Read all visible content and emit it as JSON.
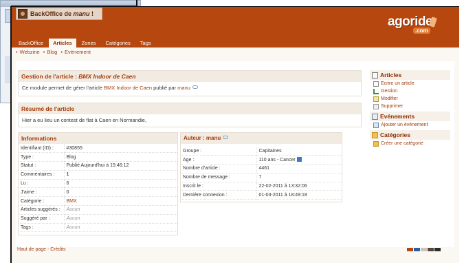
{
  "header": {
    "title_prefix": "BackOffice de ",
    "title_user": "manu",
    "title_suffix": " !",
    "brand_main": "agoride",
    "brand_sub": ".com"
  },
  "tabs": [
    {
      "label": "BackOffice",
      "active": false
    },
    {
      "label": "Articles",
      "active": true
    },
    {
      "label": "Zones",
      "active": false
    },
    {
      "label": "Catégories",
      "active": false
    },
    {
      "label": "Tags",
      "active": false
    }
  ],
  "subnav": [
    "Webzine",
    "Blog",
    "Evènement"
  ],
  "gestion": {
    "title_prefix": "Gestion de l'article : ",
    "title_article": "BMX Indoor de Caen",
    "body_prefix": "Ce module permet de gérer l'article ",
    "body_article": "BMX Indoor de Caen",
    "body_mid": " publié par ",
    "body_user": "manu"
  },
  "resume": {
    "title": "Résumé de l'article",
    "body": "Hier a eu lieu un contest de flat à Caen en Normandie,"
  },
  "informations": {
    "title": "Informations",
    "rows": [
      {
        "key": "Identifiant (ID) :",
        "value": "#30855"
      },
      {
        "key": "Type :",
        "value": "Blog"
      },
      {
        "key": "Statut :",
        "value": "Publié Aujourd'hui à 15:46:12"
      },
      {
        "key": "Commentaires :",
        "value": "1"
      },
      {
        "key": "Lu :",
        "value": "6"
      },
      {
        "key": "J'aime :",
        "value": "0"
      },
      {
        "key": "Catégorie :",
        "value": "BMX"
      },
      {
        "key": "Articles suggérés :",
        "value": "Aucun"
      },
      {
        "key": "Suggéré par :",
        "value": "Aucun"
      },
      {
        "key": "Tags :",
        "value": "Aucun"
      }
    ]
  },
  "auteur": {
    "title_prefix": "Auteur : ",
    "title_user": "manu",
    "rows": [
      {
        "key": "Groupe :",
        "value": "Capitaines"
      },
      {
        "key": "Age :",
        "value": "110 ans - Cancer"
      },
      {
        "key": "Nombre d'article :",
        "value": "4461"
      },
      {
        "key": "Nombre de message :",
        "value": "7"
      },
      {
        "key": "Inscrit le :",
        "value": "22-02-2011 à 13:32:06"
      },
      {
        "key": "Dernière connexion :",
        "value": "01-03-2011 à 18:49:18"
      }
    ]
  },
  "sidebar": {
    "articles_title": "Articles",
    "articles_items": [
      "Ecrire un article",
      "Gestion",
      "Modifier",
      "Supprimer"
    ],
    "events_title": "Evénements",
    "events_items": [
      "Ajouter un événement"
    ],
    "categories_title": "Catégories",
    "categories_items": [
      "Créer une catégorie"
    ]
  },
  "footer": {
    "top_link": "Haut de page",
    "separator": " - ",
    "credits_link": "Crédits"
  },
  "colors": {
    "header": "#b5470f",
    "accent": "#a43c0b",
    "swatches": [
      "#b5470f",
      "#2d5fa0",
      "#c9c5b8",
      "#5a4637",
      "#2b2b2b"
    ]
  }
}
